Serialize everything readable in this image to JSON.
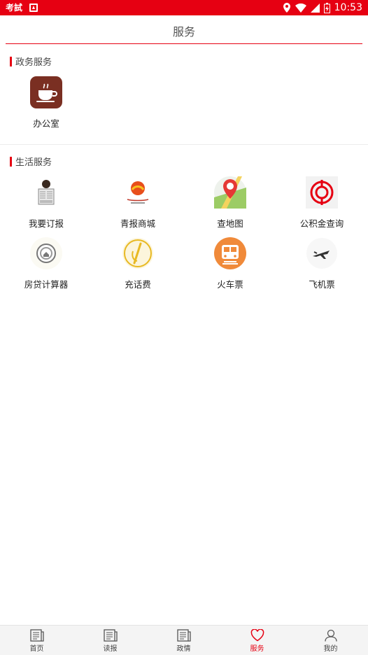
{
  "status_bar": {
    "time": "10:53",
    "logo_text": "考試"
  },
  "header": {
    "title": "服务"
  },
  "sections": {
    "gov": {
      "title": "政务服务",
      "items": [
        {
          "label": "办公室",
          "icon": "coffee-cup-icon"
        }
      ]
    },
    "life": {
      "title": "生活服务",
      "items": [
        {
          "label": "我要订报",
          "icon": "newspaper-reader-icon"
        },
        {
          "label": "青报商城",
          "icon": "qingbao-mall-logo-icon"
        },
        {
          "label": "查地图",
          "icon": "baidu-map-icon"
        },
        {
          "label": "公积金查询",
          "icon": "housing-fund-icon"
        },
        {
          "label": "房贷计算器",
          "icon": "mortgage-calculator-icon"
        },
        {
          "label": "充话费",
          "icon": "phone-recharge-icon"
        },
        {
          "label": "火车票",
          "icon": "train-ticket-icon"
        },
        {
          "label": "飞机票",
          "icon": "plane-ticket-icon"
        }
      ]
    }
  },
  "tabbar": {
    "active": "服务",
    "colors": {
      "accent": "#e60012",
      "inactive": "#444444"
    },
    "tabs": [
      {
        "label": "首页",
        "icon": "newspaper-icon"
      },
      {
        "label": "读报",
        "icon": "newspaper-icon"
      },
      {
        "label": "政情",
        "icon": "newspaper-icon"
      },
      {
        "label": "服务",
        "icon": "heart-icon"
      },
      {
        "label": "我的",
        "icon": "user-icon"
      }
    ]
  }
}
